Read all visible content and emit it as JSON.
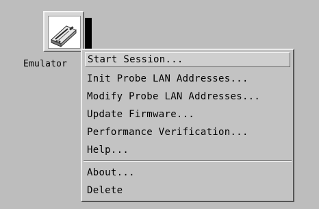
{
  "desktop": {
    "icon": {
      "label": "Emulator",
      "name": "emulator-probe-icon"
    }
  },
  "context_menu": {
    "items": [
      {
        "label": "Start Session...",
        "active": true
      },
      {
        "label": "Init Probe LAN Addresses..."
      },
      {
        "label": "Modify Probe LAN Addresses..."
      },
      {
        "label": "Update Firmware..."
      },
      {
        "label": "Performance Verification..."
      },
      {
        "label": "Help..."
      },
      {
        "label": "About..."
      },
      {
        "label": "Delete"
      }
    ]
  }
}
